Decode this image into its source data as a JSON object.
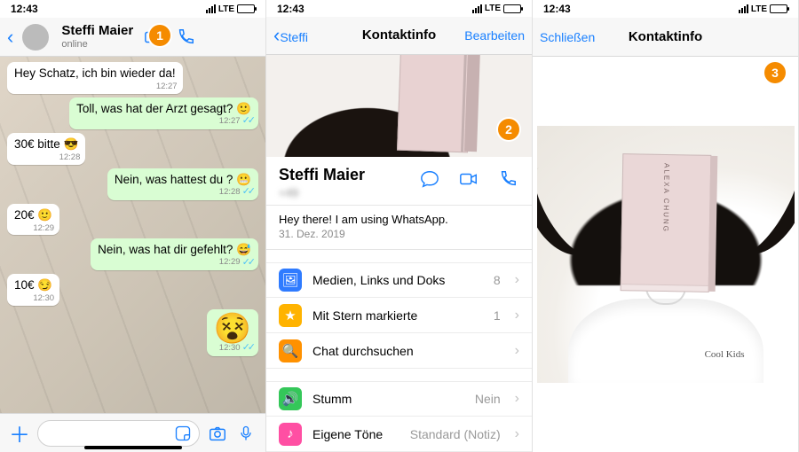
{
  "status": {
    "time": "12:43",
    "carrier": "LTE"
  },
  "badges": {
    "one": "1",
    "two": "2",
    "three": "3"
  },
  "chat": {
    "name": "Steffi  Maier",
    "presence": "online",
    "messages": [
      {
        "dir": "in",
        "text": "Hey Schatz, ich bin wieder da!",
        "time": "12:27"
      },
      {
        "dir": "out",
        "text": "Toll, was hat der Arzt gesagt? 🙂",
        "time": "12:27"
      },
      {
        "dir": "in",
        "text": "30€ bitte 😎",
        "time": "12:28"
      },
      {
        "dir": "out",
        "text": "Nein, was hattest du ? 😬",
        "time": "12:28"
      },
      {
        "dir": "in",
        "text": "20€ 🙂",
        "time": "12:29"
      },
      {
        "dir": "out",
        "text": "Nein, was hat dir gefehlt? 😅",
        "time": "12:29"
      },
      {
        "dir": "in",
        "text": "10€ 😏",
        "time": "12:30"
      },
      {
        "dir": "out",
        "text": "😵",
        "time": "12:30",
        "big": true
      }
    ]
  },
  "info": {
    "back": "Steffi",
    "title": "Kontaktinfo",
    "edit": "Bearbeiten",
    "name": "Steffi  Maier",
    "phone": "+49",
    "statusText": "Hey there! I am using WhatsApp.",
    "statusDate": "31. Dez. 2019",
    "rows": [
      {
        "icon": "🖼",
        "color": "#2f7bff",
        "label": "Medien, Links und Doks",
        "tail": "8"
      },
      {
        "icon": "★",
        "color": "#ffb300",
        "label": "Mit Stern markierte",
        "tail": "1"
      },
      {
        "icon": "🔍",
        "color": "#ff9100",
        "label": "Chat durchsuchen",
        "tail": ""
      }
    ],
    "rows2": [
      {
        "icon": "🔊",
        "color": "#34c759",
        "label": "Stumm",
        "tail": "Nein"
      },
      {
        "icon": "♪",
        "color": "#ff4fa3",
        "label": "Eigene Töne",
        "tail": "Standard (Notiz)"
      }
    ]
  },
  "photo": {
    "close": "Schließen",
    "title": "Kontaktinfo",
    "bookTitle": "ALEXA CHUNG",
    "shirt": "Cool Kids"
  }
}
